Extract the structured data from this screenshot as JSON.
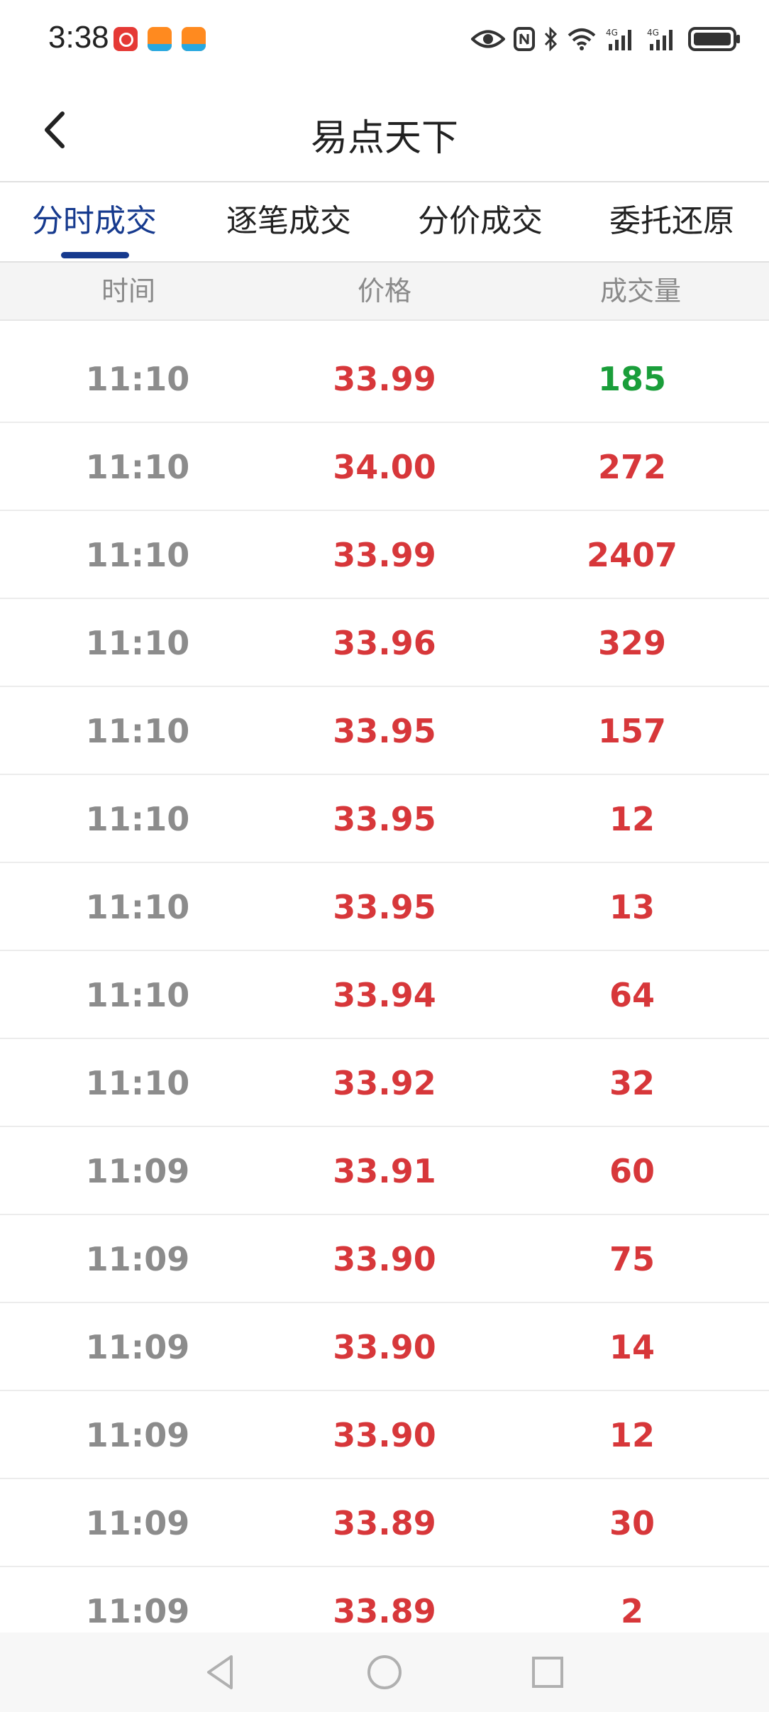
{
  "status_bar": {
    "time": "3:38",
    "icons": [
      "eye-icon",
      "nfc-icon",
      "bluetooth-icon",
      "wifi-icon",
      "signal-4g-icon",
      "signal-4g-icon",
      "battery-icon"
    ]
  },
  "header": {
    "title": "易点天下",
    "back_icon": "chevron-left-icon"
  },
  "tabs": [
    {
      "label": "分时成交",
      "active": true
    },
    {
      "label": "逐笔成交",
      "active": false
    },
    {
      "label": "分价成交",
      "active": false
    },
    {
      "label": "委托还原",
      "active": false
    }
  ],
  "columns": [
    "时间",
    "价格",
    "成交量"
  ],
  "colors": {
    "up": "#d7373a",
    "down": "#1a9e3a",
    "accent": "#163a8e",
    "muted": "#8c8c8c"
  },
  "rows": [
    {
      "time": "11:10",
      "price": "33.99",
      "volume": "185",
      "volume_color": "green"
    },
    {
      "time": "11:10",
      "price": "34.00",
      "volume": "272",
      "volume_color": "red"
    },
    {
      "time": "11:10",
      "price": "33.99",
      "volume": "2407",
      "volume_color": "red"
    },
    {
      "time": "11:10",
      "price": "33.96",
      "volume": "329",
      "volume_color": "red"
    },
    {
      "time": "11:10",
      "price": "33.95",
      "volume": "157",
      "volume_color": "red"
    },
    {
      "time": "11:10",
      "price": "33.95",
      "volume": "12",
      "volume_color": "red"
    },
    {
      "time": "11:10",
      "price": "33.95",
      "volume": "13",
      "volume_color": "red"
    },
    {
      "time": "11:10",
      "price": "33.94",
      "volume": "64",
      "volume_color": "red"
    },
    {
      "time": "11:10",
      "price": "33.92",
      "volume": "32",
      "volume_color": "red"
    },
    {
      "time": "11:09",
      "price": "33.91",
      "volume": "60",
      "volume_color": "red"
    },
    {
      "time": "11:09",
      "price": "33.90",
      "volume": "75",
      "volume_color": "red"
    },
    {
      "time": "11:09",
      "price": "33.90",
      "volume": "14",
      "volume_color": "red"
    },
    {
      "time": "11:09",
      "price": "33.90",
      "volume": "12",
      "volume_color": "red"
    },
    {
      "time": "11:09",
      "price": "33.89",
      "volume": "30",
      "volume_color": "red"
    },
    {
      "time": "11:09",
      "price": "33.89",
      "volume": "2",
      "volume_color": "red"
    }
  ],
  "navbar": {
    "icons": [
      "back-triangle-icon",
      "home-circle-icon",
      "recents-square-icon"
    ]
  }
}
